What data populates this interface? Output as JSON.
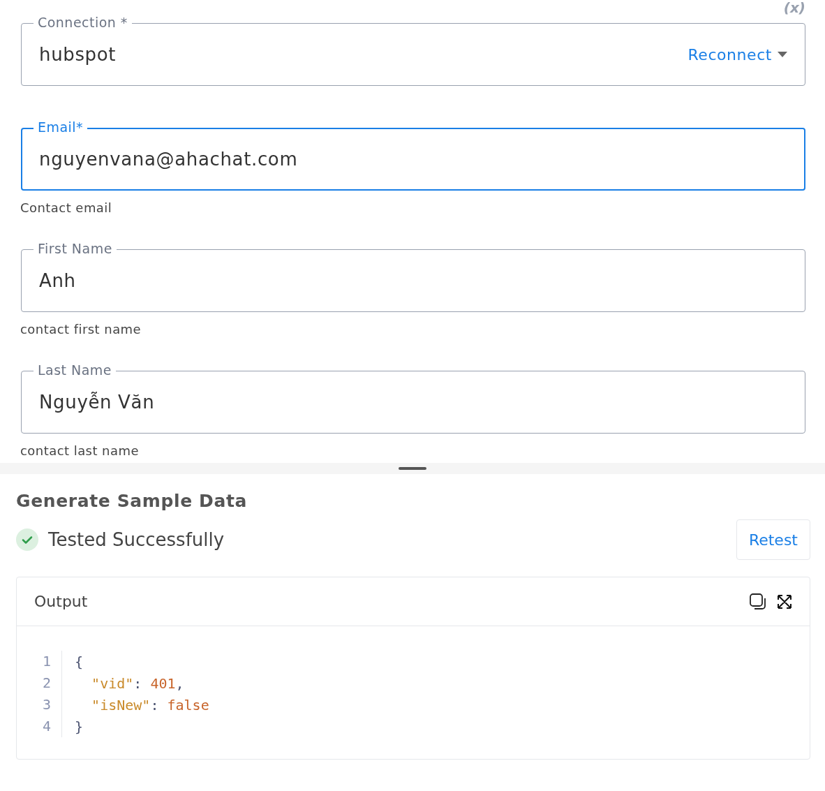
{
  "variable_button": "(x)",
  "fields": [
    {
      "label": "Connection *",
      "value": "hubspot",
      "focused": false,
      "action": "Reconnect"
    },
    {
      "label": "Email*",
      "value": "nguyenvana@ahachat.com",
      "focused": true,
      "helper": "Contact email"
    },
    {
      "label": "First Name",
      "value": "Anh",
      "focused": false,
      "helper": "contact first name"
    },
    {
      "label": "Last Name",
      "value": "Nguyễn Văn",
      "focused": false,
      "helper": "contact last name"
    }
  ],
  "sample": {
    "title": "Generate Sample Data",
    "status": "Tested Successfully",
    "retest": "Retest"
  },
  "output": {
    "title": "Output",
    "lines": [
      {
        "number": "1",
        "tokens": [
          {
            "kind": "punct",
            "text": "{"
          }
        ]
      },
      {
        "number": "2",
        "tokens": [
          {
            "kind": "key",
            "text": "\"vid\""
          },
          {
            "kind": "punct",
            "text": ": "
          },
          {
            "kind": "value",
            "text": "401"
          },
          {
            "kind": "punct",
            "text": ","
          }
        ]
      },
      {
        "number": "3",
        "tokens": [
          {
            "kind": "key",
            "text": "\"isNew\""
          },
          {
            "kind": "punct",
            "text": ": "
          },
          {
            "kind": "value",
            "text": "false"
          }
        ]
      },
      {
        "number": "4",
        "tokens": [
          {
            "kind": "punct",
            "text": "}"
          }
        ]
      }
    ]
  }
}
